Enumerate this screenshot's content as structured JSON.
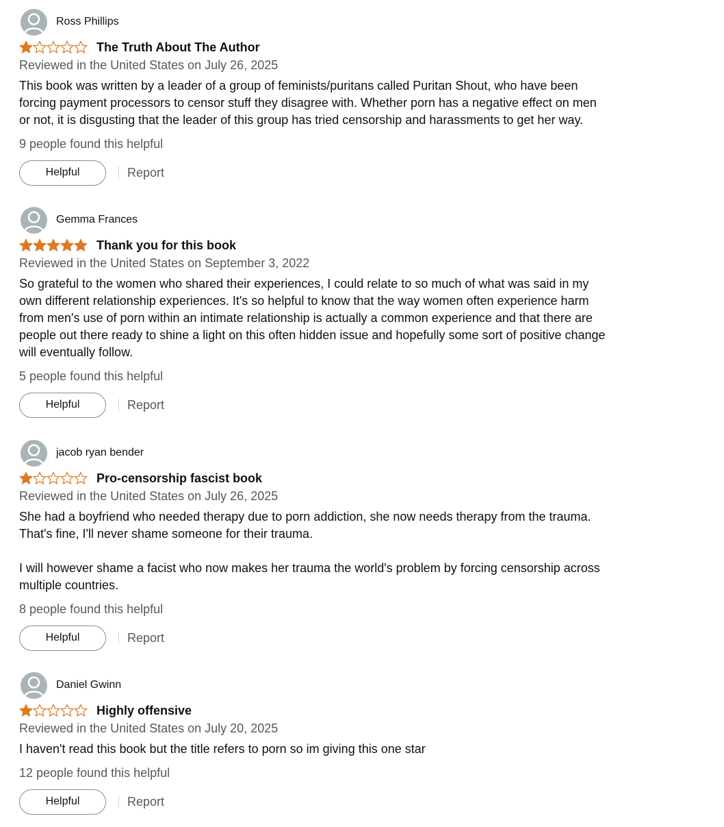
{
  "colors": {
    "star_fill": "#de7921",
    "star_outline": "#de7921",
    "avatar_bg": "#a9b3b8",
    "meta_text": "#565959"
  },
  "reviews": [
    {
      "name": "Ross Phillips",
      "rating": 1,
      "title": "The Truth About The Author",
      "meta": "Reviewed in the United States on July 26, 2025",
      "body": "This book was written by a leader of a group of feminists/puritans called Puritan Shout, who have been forcing payment processors to censor stuff they disagree with. Whether porn has a negative effect on men or not, it is disgusting that the leader of this group has tried censorship and harassments to get her way.",
      "helpful_count": "9 people found this helpful",
      "helpful_label": "Helpful",
      "report_label": "Report"
    },
    {
      "name": "Gemma Frances",
      "rating": 5,
      "title": "Thank you for this book",
      "meta": "Reviewed in the United States on September 3, 2022",
      "body": "So grateful to the women who shared their experiences, I could relate to so much of what was said in my own different relationship experiences. It's so helpful to know that the way women often experience harm from men's use of porn within an intimate relationship is actually a common experience and that there are people out there ready to shine a light on this often hidden issue and hopefully some sort of positive change will eventually follow.",
      "helpful_count": "5 people found this helpful",
      "helpful_label": "Helpful",
      "report_label": "Report"
    },
    {
      "name": "jacob ryan bender",
      "rating": 1,
      "title": "Pro-censorship fascist book",
      "meta": "Reviewed in the United States on July 26, 2025",
      "body": "She had a boyfriend who needed therapy due to porn addiction, she now needs therapy from the trauma. That's fine, I'll never shame someone for their trauma.\n\nI will however shame a facist who now makes her trauma the world's problem by forcing censorship across multiple countries.",
      "helpful_count": "8 people found this helpful",
      "helpful_label": "Helpful",
      "report_label": "Report"
    },
    {
      "name": "Daniel Gwinn",
      "rating": 1,
      "title": "Highly offensive",
      "meta": "Reviewed in the United States on July 20, 2025",
      "body": "I haven't read this book but the title refers to porn so im giving this one star",
      "helpful_count": "12 people found this helpful",
      "helpful_label": "Helpful",
      "report_label": "Report"
    }
  ]
}
